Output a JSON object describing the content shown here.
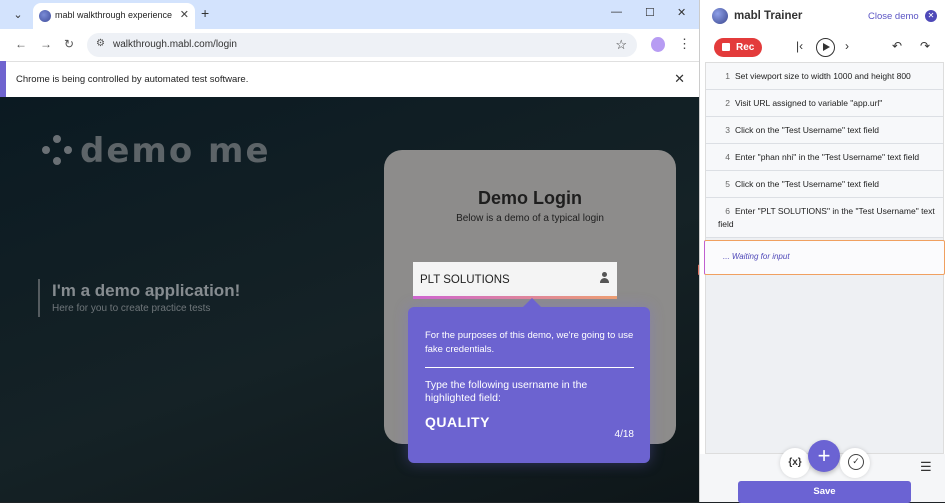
{
  "browser": {
    "tab_title": "mabl walkthrough experience",
    "new_tab": "+",
    "url": "walkthrough.mabl.com/login",
    "automation_notice": "Chrome is being controlled by automated test software."
  },
  "page": {
    "logo_text": "demo me",
    "hero_title": "I'm a demo application!",
    "hero_subtitle": "Here for you to create practice tests",
    "login_title": "Demo Login",
    "login_subtitle": "Below is a demo of a typical login",
    "username_value": "PLT SOLUTIONS"
  },
  "tooltip": {
    "text1": "For the purposes of this demo, we're going to use fake credentials.",
    "text2": "Type the following username in the highlighted field:",
    "username": "QUALITY",
    "progress": "4/18"
  },
  "trainer": {
    "title": "mabl Trainer",
    "close_label": "Close demo",
    "rec_label": "Rec",
    "steps": [
      {
        "n": "1",
        "text": "Set viewport size to width 1000 and height 800"
      },
      {
        "n": "2",
        "text": "Visit URL assigned to variable \"app.url\""
      },
      {
        "n": "3",
        "text": "Click on the \"Test Username\" text field"
      },
      {
        "n": "4",
        "text": "Enter \"phan nhi\" in the \"Test Username\" text field"
      },
      {
        "n": "5",
        "text": "Click on the \"Test Username\" text field"
      },
      {
        "n": "6",
        "text": "Enter \"PLT SOLUTIONS\" in the \"Test Username\" text field"
      }
    ],
    "waiting_text": "... Waiting for input",
    "vars_label": "{x}",
    "add_label": "+",
    "save_label": "Save"
  },
  "colors": {
    "accent": "#6b63d3",
    "record": "#e33b3b"
  }
}
